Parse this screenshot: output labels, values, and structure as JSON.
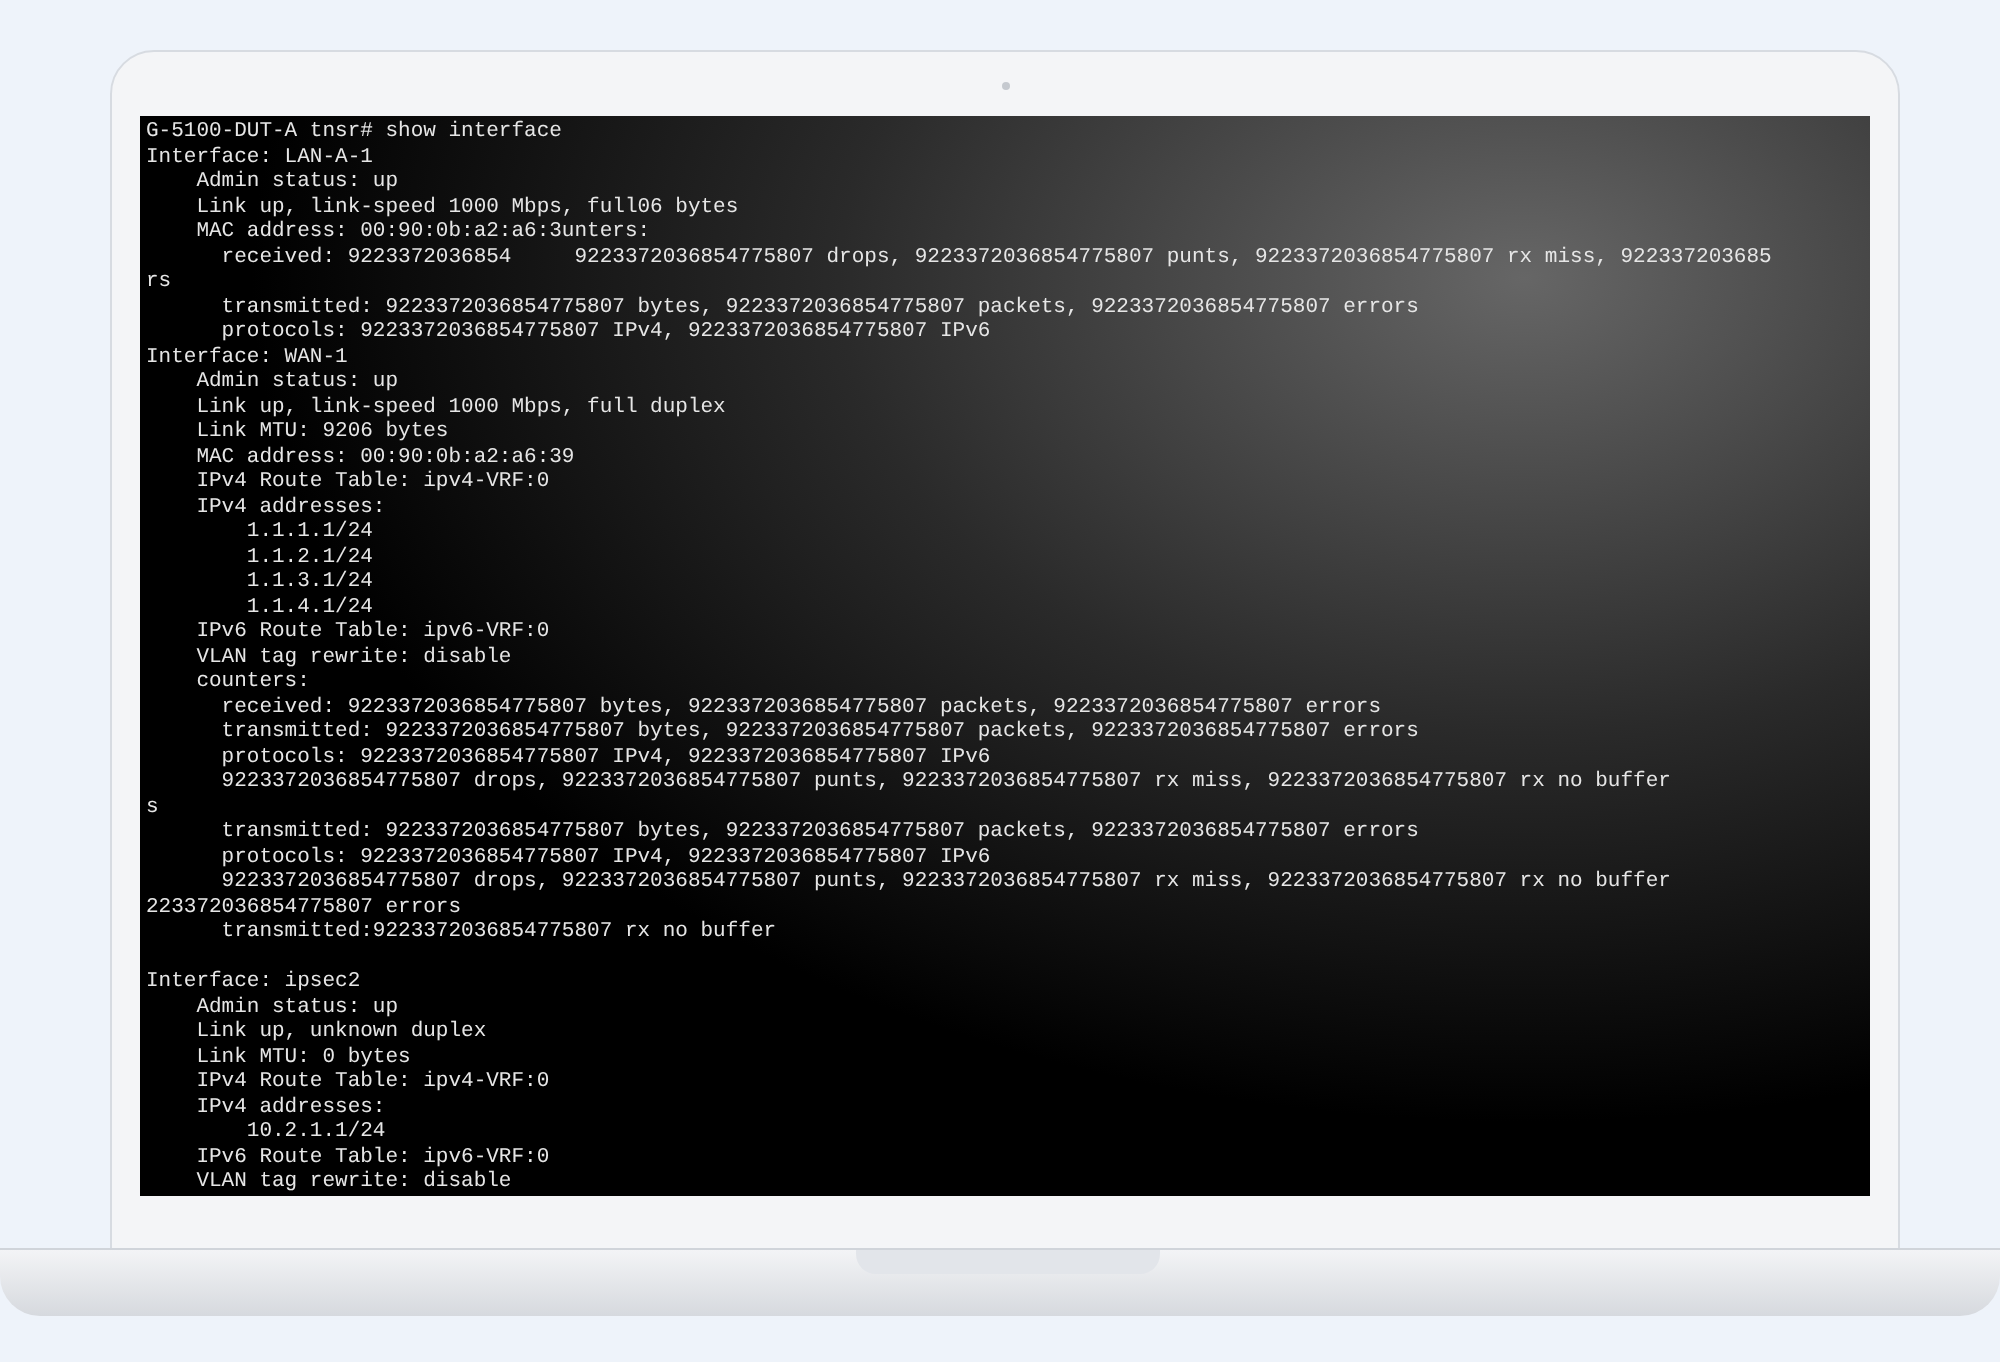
{
  "terminal": {
    "blocks": [
      {
        "lines": [
          "G-5100-DUT-A tnsr# show interface",
          "Interface: LAN-A-1",
          "    Admin status: up",
          "    Link up, link-speed 1000 Mbps, full06 bytes",
          "    MAC address: 00:90:0b:a2:a6:3unters:",
          "      received: 9223372036854     9223372036854775807 drops, 9223372036854775807 punts, 9223372036854775807 rx miss, 922337203685",
          "rs",
          "      transmitted: 9223372036854775807 bytes, 9223372036854775807 packets, 9223372036854775807 errors",
          "      protocols: 9223372036854775807 IPv4, 9223372036854775807 IPv6",
          "Interface: WAN-1",
          "    Admin status: up",
          "    Link up, link-speed 1000 Mbps, full duplex",
          "    Link MTU: 9206 bytes",
          "    MAC address: 00:90:0b:a2:a6:39",
          "    IPv4 Route Table: ipv4-VRF:0",
          "    IPv4 addresses:",
          "        1.1.1.1/24",
          "        1.1.2.1/24",
          "        1.1.3.1/24",
          "        1.1.4.1/24",
          "    IPv6 Route Table: ipv6-VRF:0",
          "    VLAN tag rewrite: disable",
          "    counters:",
          "      received: 9223372036854775807 bytes, 9223372036854775807 packets, 9223372036854775807 errors",
          "      transmitted: 9223372036854775807 bytes, 9223372036854775807 packets, 9223372036854775807 errors",
          "      protocols: 9223372036854775807 IPv4, 9223372036854775807 IPv6",
          "      9223372036854775807 drops, 9223372036854775807 punts, 9223372036854775807 rx miss, 9223372036854775807 rx no buffer",
          "s",
          "      transmitted: 9223372036854775807 bytes, 9223372036854775807 packets, 9223372036854775807 errors",
          "      protocols: 9223372036854775807 IPv4, 9223372036854775807 IPv6",
          "      9223372036854775807 drops, 9223372036854775807 punts, 9223372036854775807 rx miss, 9223372036854775807 rx no buffer",
          "223372036854775807 errors",
          "      transmitted:9223372036854775807 rx no buffer"
        ]
      },
      {
        "lines": [
          "Interface: ipsec2",
          "    Admin status: up",
          "    Link up, unknown duplex",
          "    Link MTU: 0 bytes",
          "    IPv4 Route Table: ipv4-VRF:0",
          "    IPv4 addresses:",
          "        10.2.1.1/24",
          "    IPv6 Route Table: ipv6-VRF:0",
          "    VLAN tag rewrite: disable"
        ]
      }
    ]
  }
}
